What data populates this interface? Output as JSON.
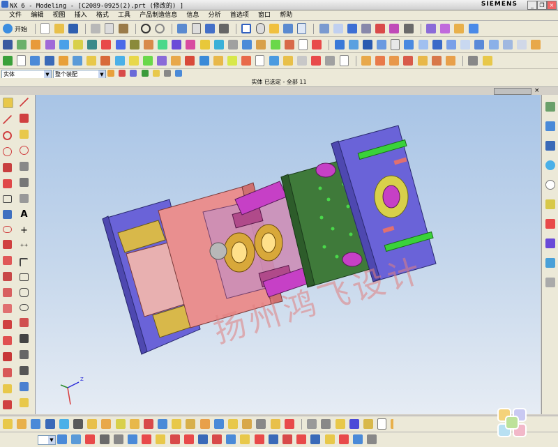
{
  "window": {
    "title": "NX 6 - Modeling - [C2089-0925(2).prt  (修改的) ]",
    "brand": "SIEMENS",
    "controls": [
      "_",
      "❐",
      "×"
    ]
  },
  "menu": [
    "文件",
    "编辑",
    "视图",
    "插入",
    "格式",
    "工具",
    "产品制造信息",
    "信息",
    "分析",
    "首选项",
    "窗口",
    "帮助"
  ],
  "toolbar1": {
    "start_label": "开始"
  },
  "selection": {
    "type_filter": "实体",
    "scope": "整个装配"
  },
  "status": {
    "text": "实体 已选定 - 全部 11"
  },
  "watermark": {
    "text": "扬州鸿飞设计"
  },
  "triad": {
    "z_label": "Z"
  },
  "colors": {
    "plate_purple": "#6a63d8",
    "cavity_pink": "#e98f8f",
    "plate_green": "#3f7a3a",
    "pin_magenta": "#c640c6",
    "pin_green": "#3ad23a",
    "insert_gold": "#d8b84a",
    "viewport_top": "#a8c4e6",
    "viewport_bottom": "#e6ecf4"
  }
}
